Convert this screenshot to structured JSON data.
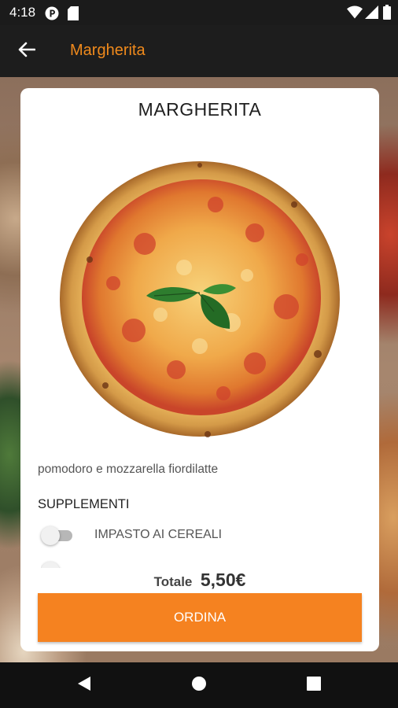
{
  "status_bar": {
    "time": "4:18",
    "icons": [
      "notification-p-icon",
      "sd-card-icon",
      "wifi-icon",
      "signal-icon",
      "battery-icon"
    ]
  },
  "app_bar": {
    "back_icon": "arrow-back-icon",
    "title": "Margherita",
    "accent_color": "#f08a1c"
  },
  "product": {
    "name": "MARGHERITA",
    "image": "margherita-pizza",
    "description": "pomodoro e mozzarella fiordilatte"
  },
  "supplements": {
    "title": "SUPPLEMENTI",
    "items": [
      {
        "label": "IMPASTO AI CEREALI",
        "enabled": false
      }
    ]
  },
  "order": {
    "total_label": "Totale",
    "total_value": "5,50€",
    "button_label": "ORDINA",
    "button_color": "#f58220"
  },
  "nav_bar": {
    "icons": [
      "back-triangle-icon",
      "home-circle-icon",
      "recents-square-icon"
    ]
  }
}
